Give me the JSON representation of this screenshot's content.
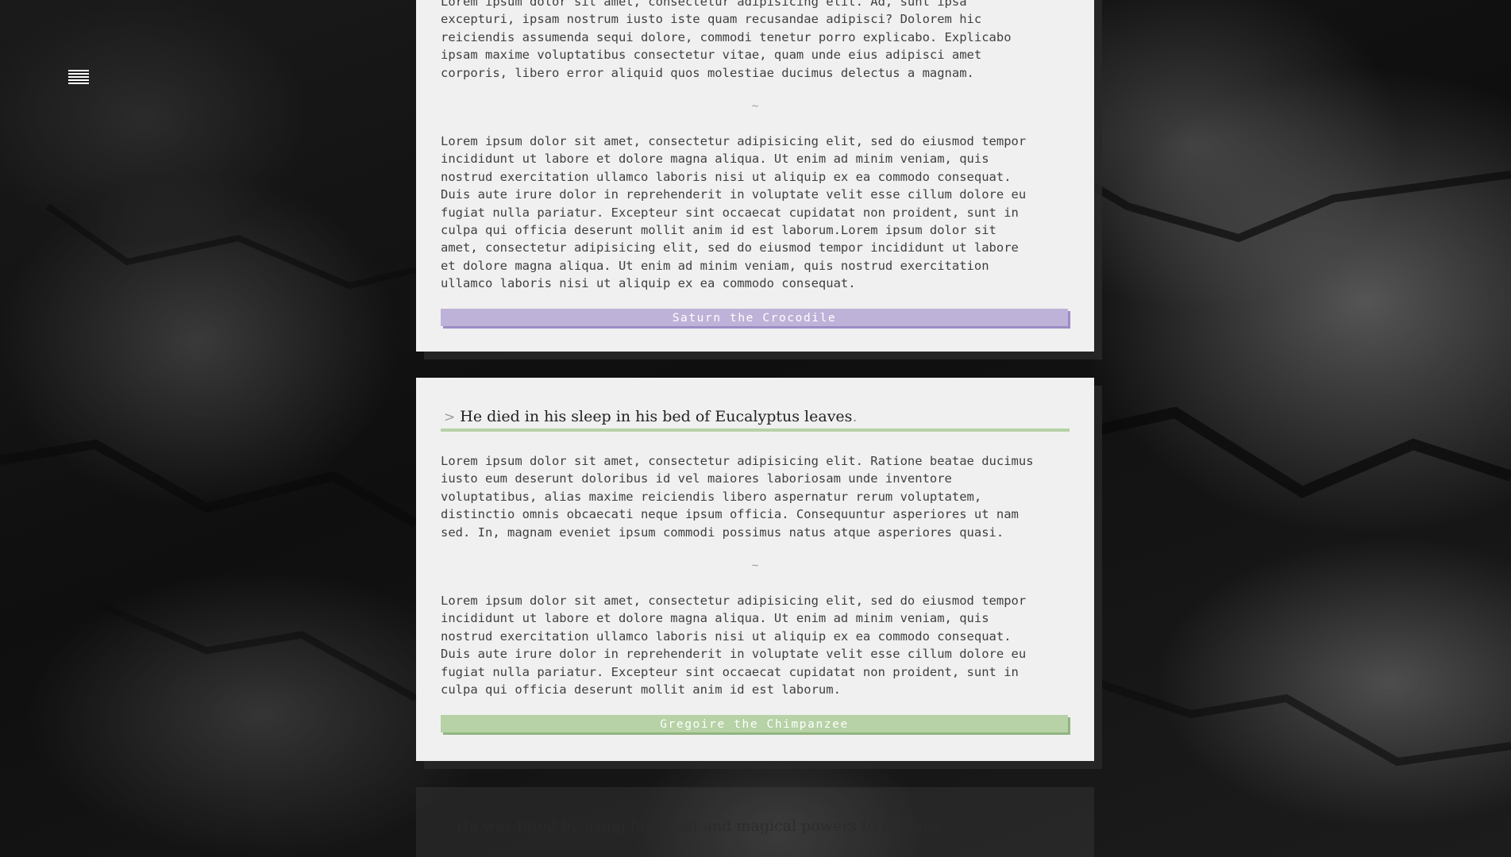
{
  "menu": {
    "icon": "hamburger-menu-icon"
  },
  "cards": [
    {
      "paragraph1": "Lorem ipsum dolor sit amet, consectetur adipisicing elit. Ad, sunt ipsa\nexcepturi, ipsam nostrum iusto iste quam recusandae adipisci? Dolorem hic\nreiciendis assumenda sequi dolore, commodi tenetur porro explicabo. Explicabo\nipsam maxime voluptatibus consectetur vitae, quam unde eius adipisci amet\ncorporis, libero error aliquid quos molestiae ducimus delectus a magnam.",
      "separator": "~",
      "paragraph2": "Lorem ipsum dolor sit amet, consectetur adipisicing elit, sed do eiusmod tempor\nincididunt ut labore et dolore magna aliqua. Ut enim ad minim veniam, quis\nnostrud exercitation ullamco laboris nisi ut aliquip ex ea commodo consequat.\nDuis aute irure dolor in reprehenderit in voluptate velit esse cillum dolore eu\nfugiat nulla pariatur. Excepteur sint occaecat cupidatat non proident, sunt in\nculpa qui officia deserunt mollit anim id est laborum.Lorem ipsum dolor sit\namet, consectetur adipisicing elit, sed do eiusmod tempor incididunt ut labore\net dolore magna aliqua. Ut enim ad minim veniam, quis nostrud exercitation\nullamco laboris nisi ut aliquip ex ea commodo consequat.",
      "button_label": "Saturn the Crocodile",
      "button_color": "#bfb2d8"
    },
    {
      "title_prefix": ">",
      "title": "He died in his sleep in his bed of Eucalyptus leaves",
      "title_suffix": ".",
      "paragraph1": "Lorem ipsum dolor sit amet, consectetur adipisicing elit. Ratione beatae ducimus\niusto eum deserunt doloribus id vel maiores laboriosam unde inventore\nvoluptatibus, alias maxime reiciendis libero aspernatur rerum voluptatem,\ndistinctio omnis obcaecati neque ipsum officia. Consequuntur asperiores ut nam\nsed. In, magnam eveniet ipsum commodi possimus natus atque asperiores quasi.",
      "separator": "~",
      "paragraph2": "Lorem ipsum dolor sit amet, consectetur adipisicing elit, sed do eiusmod tempor\nincididunt ut labore et dolore magna aliqua. Ut enim ad minim veniam, quis\nnostrud exercitation ullamco laboris nisi ut aliquip ex ea commodo consequat.\nDuis aute irure dolor in reprehenderit in voluptate velit esse cillum dolore eu\nfugiat nulla pariatur. Excepteur sint occaecat cupidatat non proident, sunt in\nculpa qui officia deserunt mollit anim id est laborum.",
      "button_label": "Gregoire the Chimpanzee",
      "button_color": "#b6d2a6"
    }
  ],
  "footer": {
    "partial_text": "He was fated by using his great and magical powers to become"
  }
}
